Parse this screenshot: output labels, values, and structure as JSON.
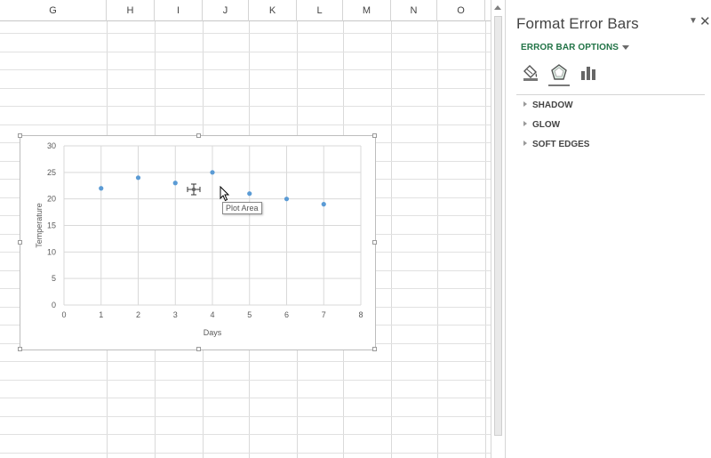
{
  "columns": [
    "G",
    "H",
    "I",
    "J",
    "K",
    "L",
    "M",
    "N",
    "O"
  ],
  "chart": {
    "tooltip": "Plot Area"
  },
  "chart_data": {
    "type": "scatter",
    "x": [
      1,
      2,
      3,
      4,
      5,
      6,
      7
    ],
    "y": [
      22,
      24,
      23,
      25,
      21,
      20,
      19
    ],
    "xlabel": "Days",
    "ylabel": "Temperature",
    "xlim": [
      0,
      8
    ],
    "ylim": [
      0,
      30
    ],
    "xticks": [
      "0",
      "1",
      "2",
      "3",
      "4",
      "5",
      "6",
      "7",
      "8"
    ],
    "yticks": [
      "0",
      "5",
      "10",
      "15",
      "20",
      "25",
      "30"
    ],
    "grid": true,
    "marker_color": "#5b9bd5"
  },
  "pane": {
    "title": "Format Error Bars",
    "options_icon": "chevron-down-icon",
    "close_label": "✕",
    "section_tab": "ERROR BAR OPTIONS",
    "icons": [
      "fill-line-icon",
      "effects-icon",
      "error-bar-options-icon"
    ],
    "rows": [
      "SHADOW",
      "GLOW",
      "SOFT EDGES"
    ],
    "accent_color": "#217346"
  }
}
